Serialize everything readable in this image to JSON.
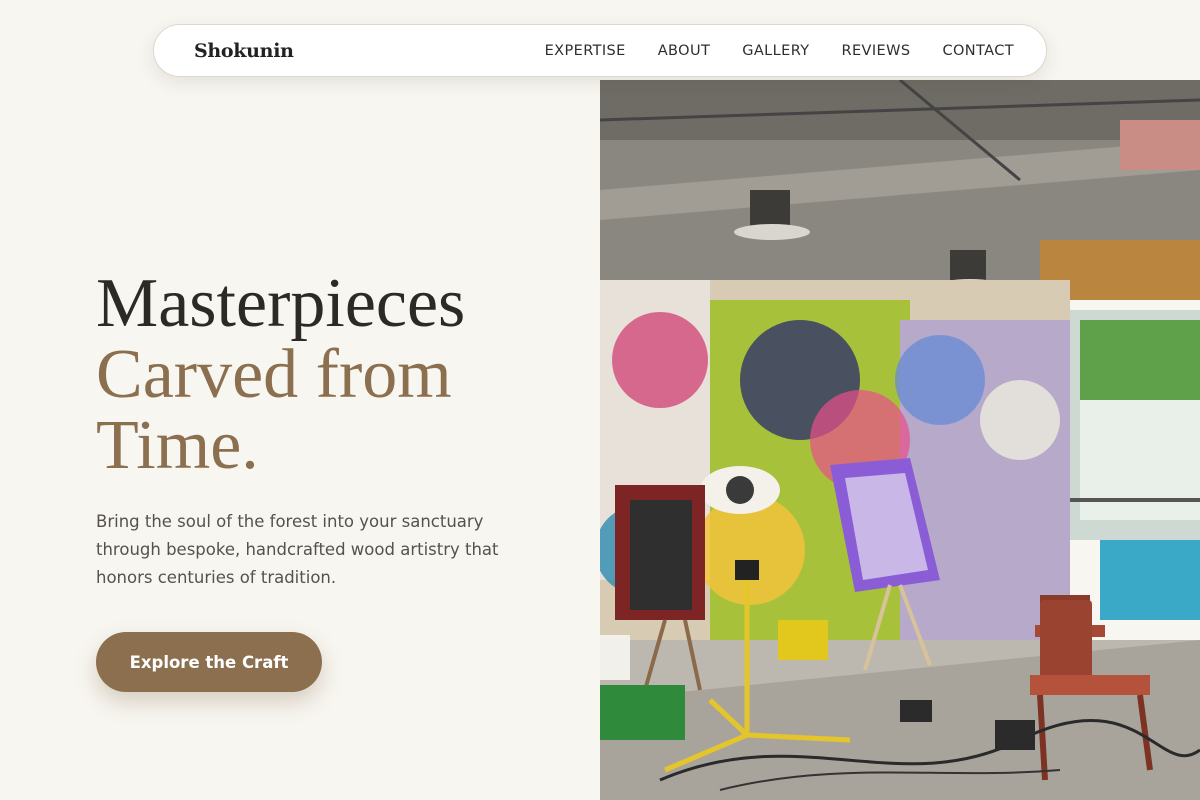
{
  "brand": "Shokunin",
  "nav": {
    "links": [
      "EXPERTISE",
      "ABOUT",
      "GALLERY",
      "REVIEWS",
      "CONTACT"
    ]
  },
  "hero": {
    "title_line1": "Masterpieces",
    "title_line2a": "Carved from",
    "title_line2b": "Time.",
    "subtitle": "Bring the soul of the forest into your sanctuary through bespoke, handcrafted wood artistry that honors centuries of tradition.",
    "cta_label": "Explore the Craft"
  },
  "colors": {
    "background": "#f8f6f1",
    "accent": "#8b6f4f",
    "text": "#2b2a27"
  },
  "image": {
    "subject": "graffiti-covered art studio with easels, canvases and chairs"
  }
}
